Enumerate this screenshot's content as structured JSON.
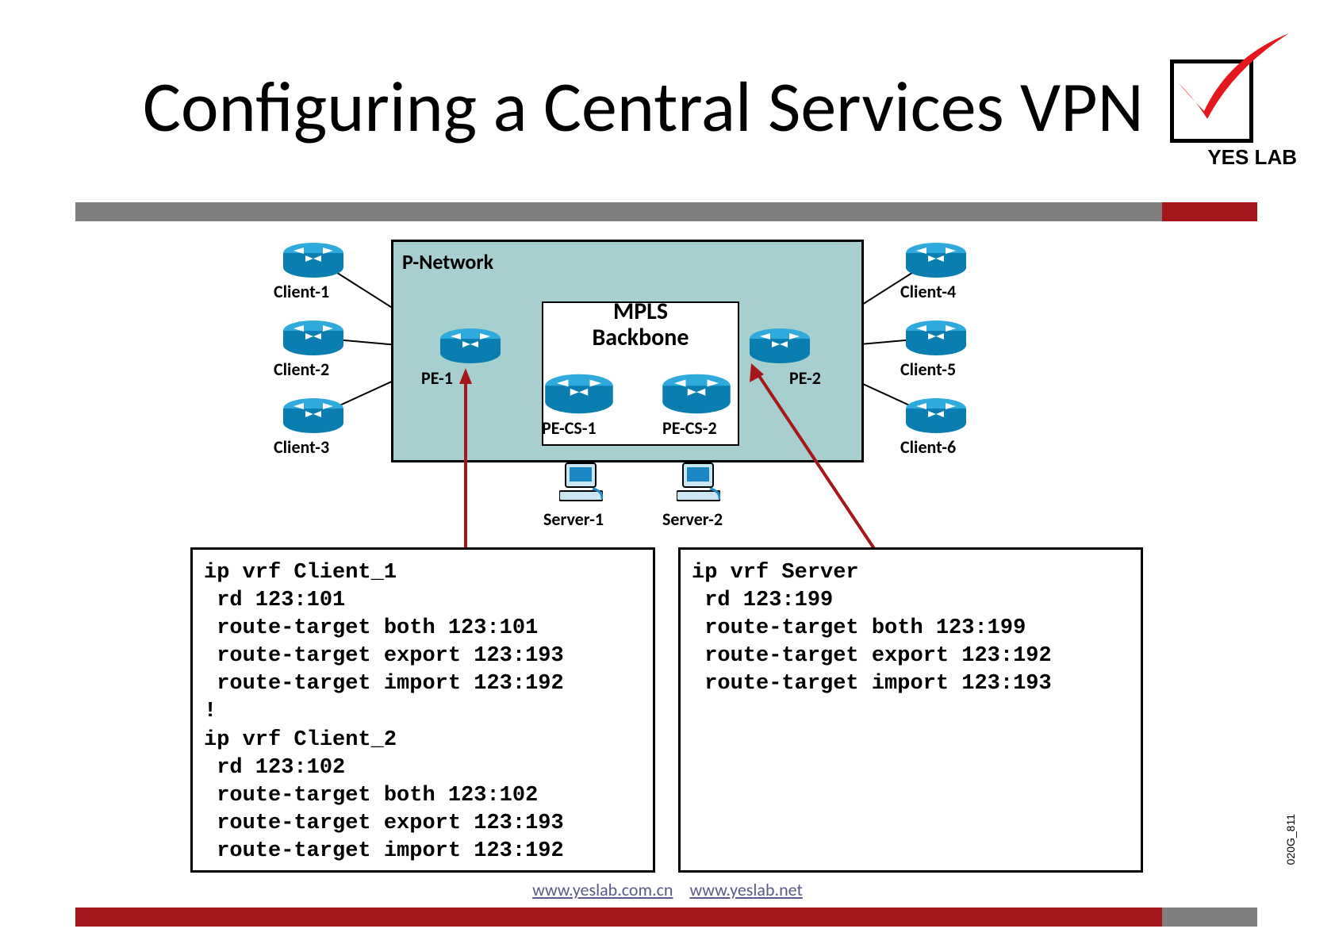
{
  "title": "Configuring a Central Services VPN",
  "logo_text": "YES LAB",
  "diagram": {
    "pnetwork": "P-Network",
    "mpls_line1": "MPLS",
    "mpls_line2": "Backbone",
    "clients_left": [
      "Client-1",
      "Client-2",
      "Client-3"
    ],
    "clients_right": [
      "Client-4",
      "Client-5",
      "Client-6"
    ],
    "pe1": "PE-1",
    "pe2": "PE-2",
    "pecs1": "PE-CS-1",
    "pecs2": "PE-CS-2",
    "server1": "Server-1",
    "server2": "Server-2"
  },
  "config_left": "ip vrf Client_1\n rd 123:101\n route-target both 123:101\n route-target export 123:193\n route-target import 123:192\n!\nip vrf Client_2\n rd 123:102\n route-target both 123:102\n route-target export 123:193\n route-target import 123:192",
  "config_right": "ip vrf Server\n rd 123:199\n route-target both 123:199\n route-target export 123:192\n route-target import 123:193",
  "footer": {
    "link1": "www.yeslab.com.cn",
    "link2": "www.yeslab.net"
  },
  "slidecode": "020G_811"
}
